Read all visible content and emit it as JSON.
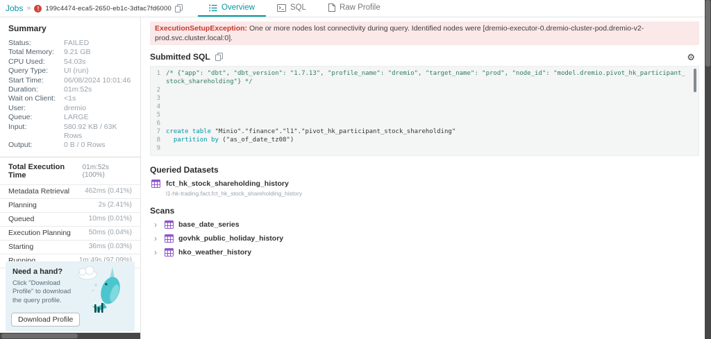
{
  "colors": {
    "accent": "#0096a5",
    "error_red": "#c8372d",
    "dataset_purple": "#8e55cc",
    "error_banner_bg": "#fbe8e8"
  },
  "icons": {
    "gear": "⚙",
    "chevron": "›",
    "error_badge": "!"
  },
  "header": {
    "breadcrumb": "Jobs",
    "breadcrumb_sep": "»",
    "job_id": "199c4474-eca5-2650-eb1c-3dfac7fd6000",
    "tabs": [
      {
        "label": "Overview"
      },
      {
        "label": "SQL"
      },
      {
        "label": "Raw Profile"
      }
    ]
  },
  "summary": {
    "title": "Summary",
    "rows": [
      {
        "label": "Status:",
        "value": "FAILED"
      },
      {
        "label": "Total Memory:",
        "value": "9.21 GB"
      },
      {
        "label": "CPU Used:",
        "value": "54.03s"
      },
      {
        "label": "Query Type:",
        "value": "UI (run)"
      },
      {
        "label": "Start Time:",
        "value": "06/08/2024 10:01:46"
      },
      {
        "label": "Duration:",
        "value": "01m:52s"
      },
      {
        "label": "Wait on Client:",
        "value": "<1s"
      },
      {
        "label": "User:",
        "value": "dremio"
      },
      {
        "label": "Queue:",
        "value": "LARGE"
      },
      {
        "label": "Input:",
        "value": "580.92 KB / 63K Rows"
      },
      {
        "label": "Output:",
        "value": "0 B / 0 Rows"
      }
    ]
  },
  "execution": {
    "title": "Total Execution Time",
    "total": "01m:52s (100%)",
    "phases": [
      {
        "label": "Metadata Retrieval",
        "value": "462ms (0.41%)"
      },
      {
        "label": "Planning",
        "value": "2s (2.41%)"
      },
      {
        "label": "Queued",
        "value": "10ms (0.01%)"
      },
      {
        "label": "Execution Planning",
        "value": "50ms (0.04%)"
      },
      {
        "label": "Starting",
        "value": "36ms (0.03%)"
      },
      {
        "label": "Running",
        "value": "1m:49s (97.09%)"
      }
    ]
  },
  "help": {
    "title": "Need a hand?",
    "text": "Click \"Download Profile\" to download the query profile.",
    "button": "Download Profile"
  },
  "main": {
    "error_title": "ExecutionSetupException:",
    "error_body": " One or more nodes lost connectivity during query. Identified nodes were [dremio-executor-0.dremio-cluster-pod.dremio-v2-prod.svc.cluster.local:0].",
    "submitted_sql_title": "Submitted SQL",
    "queried_datasets_title": "Queried Datasets",
    "dataset": {
      "name": "fct_hk_stock_shareholding_history",
      "path": "l1-hk-trading.fact.fct_hk_stock_shareholding_history"
    },
    "scans_title": "Scans",
    "scans": [
      {
        "name": "base_date_series"
      },
      {
        "name": "govhk_public_holiday_history"
      },
      {
        "name": "hko_weather_history"
      }
    ]
  },
  "sql": {
    "lines": [
      {
        "num": "1",
        "comment": "/* {\"app\": \"dbt\", \"dbt_version\": \"1.7.13\", \"profile_name\": \"dremio\", \"target_name\": \"prod\", \"node_id\": \"model.dremio.pivot_hk_participant_stock_shareholding\"} */"
      },
      {
        "num": "2"
      },
      {
        "num": "3"
      },
      {
        "num": "4"
      },
      {
        "num": "5"
      },
      {
        "num": "6"
      },
      {
        "num": "7",
        "kw": "create table ",
        "rest": "\"Minio\".\"finance\".\"l1\".\"pivot_hk_participant_stock_shareholding\""
      },
      {
        "num": "8",
        "kw": "  partition by ",
        "rest": "(\"as_of_date_tz08\")"
      },
      {
        "num": "9"
      }
    ]
  }
}
